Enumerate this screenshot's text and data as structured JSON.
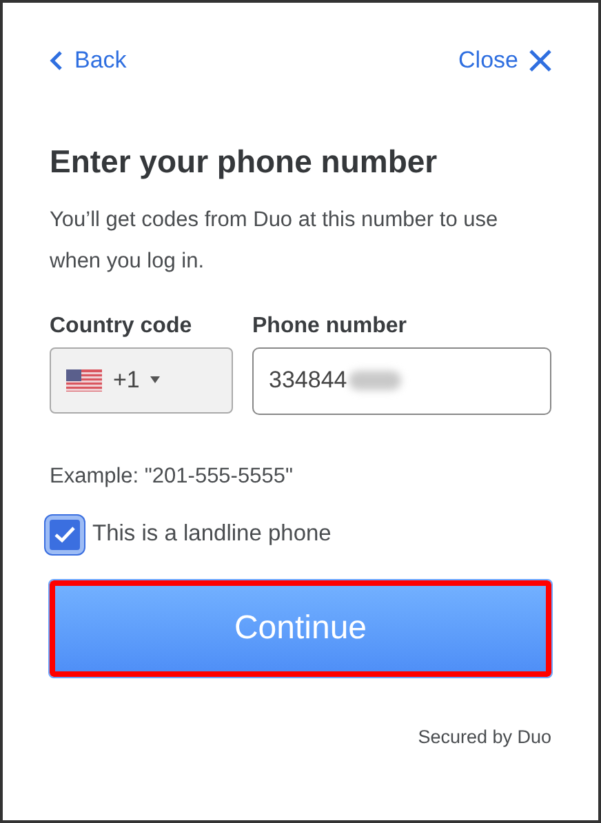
{
  "nav": {
    "back": "Back",
    "close": "Close"
  },
  "title": "Enter your phone number",
  "description": "You’ll get codes from Duo at this number to use when you log in.",
  "country_code": {
    "label": "Country code",
    "value": "+1"
  },
  "phone_number": {
    "label": "Phone number",
    "value": "334844",
    "redacted": true
  },
  "example": "Example: \"201-555-5555\"",
  "landline": {
    "label": "This is a landline phone",
    "checked": true
  },
  "continue_button": {
    "label": "Continue",
    "highlighted": true
  },
  "footer": "Secured by Duo"
}
